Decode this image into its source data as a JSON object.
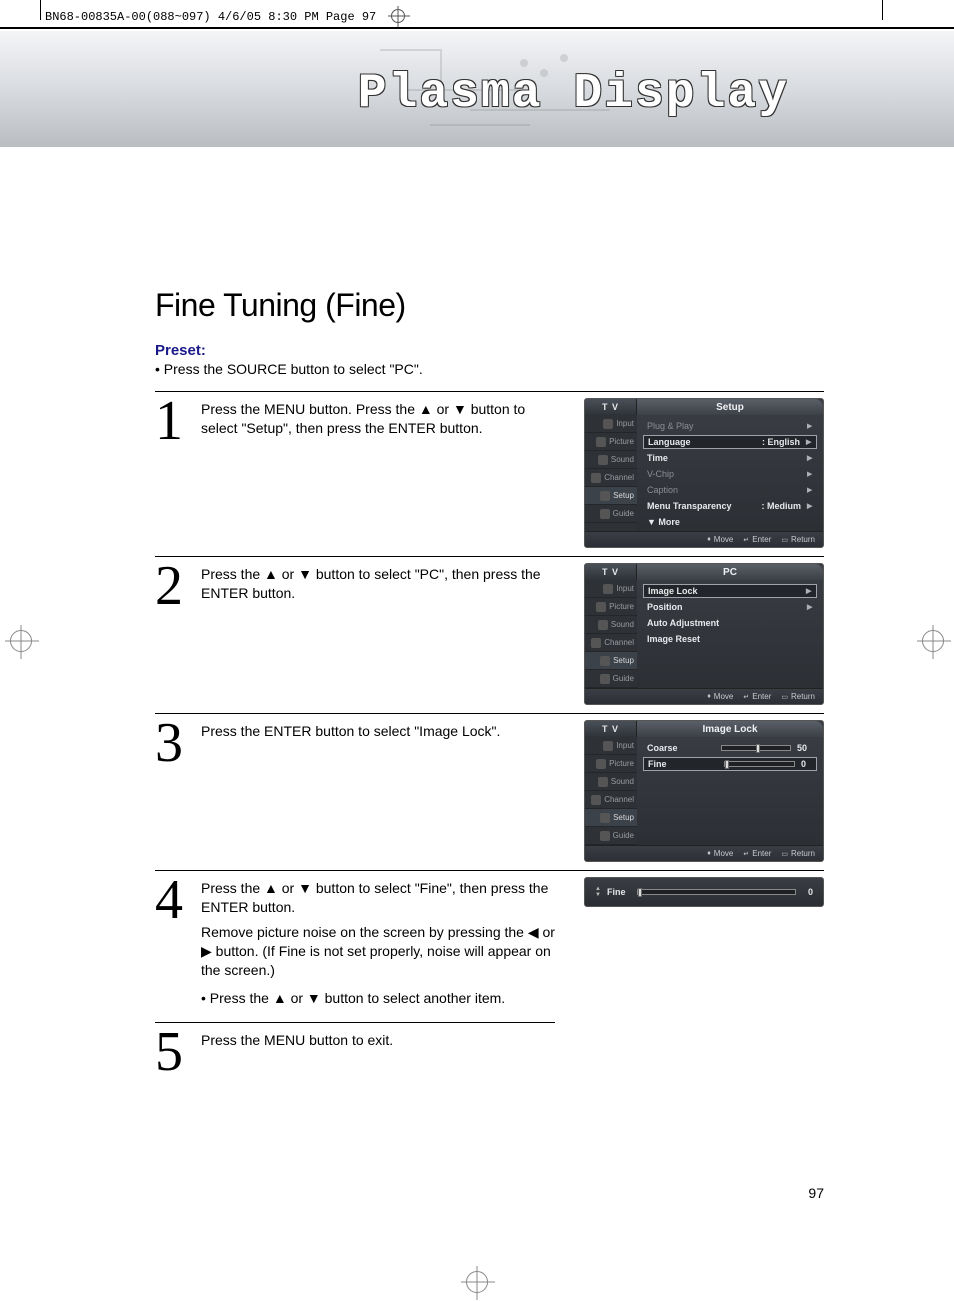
{
  "print_header": "BN68-00835A-00(088~097)  4/6/05  8:30 PM  Page 97",
  "banner_title": "Plasma Display",
  "section_title": "Fine Tuning (Fine)",
  "preset": {
    "label": "Preset:",
    "bullet1": "•   Press the SOURCE button to select \"PC\"."
  },
  "steps": {
    "s1": {
      "num": "1",
      "text": "Press the MENU button. Press the ▲ or ▼ button to select \"Setup\", then press the ENTER button."
    },
    "s2": {
      "num": "2",
      "text": "Press the ▲ or ▼ button to select \"PC\", then press the ENTER button."
    },
    "s3": {
      "num": "3",
      "text": "Press the ENTER button to select \"Image Lock\"."
    },
    "s4": {
      "num": "4",
      "p1": "Press the ▲ or ▼ button to select \"Fine\", then press the ENTER button.",
      "p2": "Remove picture noise on the screen by pressing the ◀ or ▶ button. (If Fine is not set properly, noise  will appear on the screen.)",
      "p3": "•  Press the ▲ or ▼ button to select another item."
    },
    "s5": {
      "num": "5",
      "text": "Press the MENU button to exit."
    }
  },
  "osd_common": {
    "source": "T V",
    "nav": [
      "Input",
      "Picture",
      "Sound",
      "Channel",
      "Setup",
      "Guide"
    ],
    "footer": {
      "move": "Move",
      "enter": "Enter",
      "return": "Return"
    }
  },
  "osd1": {
    "title": "Setup",
    "rows": [
      {
        "label": "Plug & Play",
        "value": "",
        "arrow": true,
        "hl": false,
        "bright": false
      },
      {
        "label": "Language",
        "value": ": English",
        "arrow": true,
        "hl": true,
        "bright": true
      },
      {
        "label": "Time",
        "value": "",
        "arrow": true,
        "hl": false,
        "bright": true
      },
      {
        "label": "V-Chip",
        "value": "",
        "arrow": true,
        "hl": false,
        "bright": false
      },
      {
        "label": "Caption",
        "value": "",
        "arrow": true,
        "hl": false,
        "bright": false
      },
      {
        "label": "Menu Transparency",
        "value": ": Medium",
        "arrow": true,
        "hl": false,
        "bright": true
      },
      {
        "label": "▼ More",
        "value": "",
        "arrow": false,
        "hl": false,
        "bright": true
      }
    ]
  },
  "osd2": {
    "title": "PC",
    "rows": [
      {
        "label": "Image Lock",
        "value": "",
        "arrow": true,
        "hl": true,
        "bright": true
      },
      {
        "label": "Position",
        "value": "",
        "arrow": true,
        "hl": false,
        "bright": true
      },
      {
        "label": "Auto Adjustment",
        "value": "",
        "arrow": false,
        "hl": false,
        "bright": true
      },
      {
        "label": "Image Reset",
        "value": "",
        "arrow": false,
        "hl": false,
        "bright": true
      }
    ]
  },
  "osd3": {
    "title": "Image Lock",
    "rows": [
      {
        "label": "Coarse",
        "value": "50",
        "slider": 50,
        "hl": false,
        "bright": true
      },
      {
        "label": "Fine",
        "value": "0",
        "slider": 0,
        "hl": true,
        "bright": true
      }
    ]
  },
  "slim": {
    "label": "Fine",
    "value": "0",
    "slider": 0
  },
  "page_number": "97"
}
